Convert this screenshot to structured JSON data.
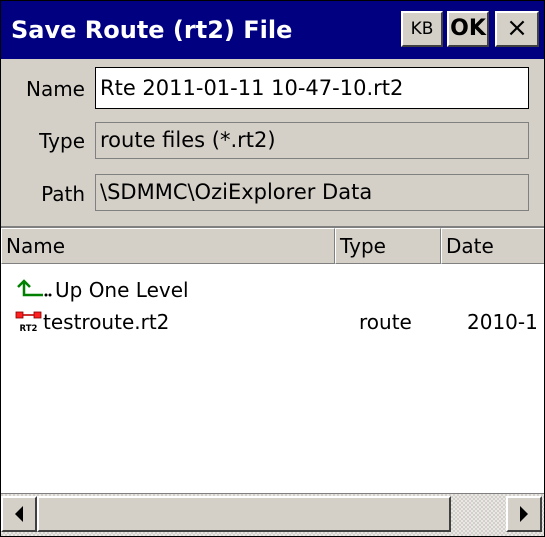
{
  "window": {
    "title": "Save Route (rt2) File",
    "kb_label": "KB",
    "ok_label": "OK",
    "close_label": "×"
  },
  "form": {
    "name_label": "Name",
    "name_value": "Rte 2011-01-11 10-47-10.rt2",
    "type_label": "Type",
    "type_value": "route files (*.rt2)",
    "path_label": "Path",
    "path_value": "\\SDMMC\\OziExplorer Data"
  },
  "list": {
    "columns": [
      "Name",
      "Type",
      "Date"
    ],
    "rows": [
      {
        "icon": "up-level-icon",
        "name": "Up One Level",
        "type": "",
        "date": ""
      },
      {
        "icon": "route-file-icon",
        "icon_text": "RT2",
        "name": "testroute.rt2",
        "type": "route",
        "date": "2010-1"
      }
    ]
  },
  "colors": {
    "titlebar": "#000080",
    "panel": "#d4d0c8"
  }
}
